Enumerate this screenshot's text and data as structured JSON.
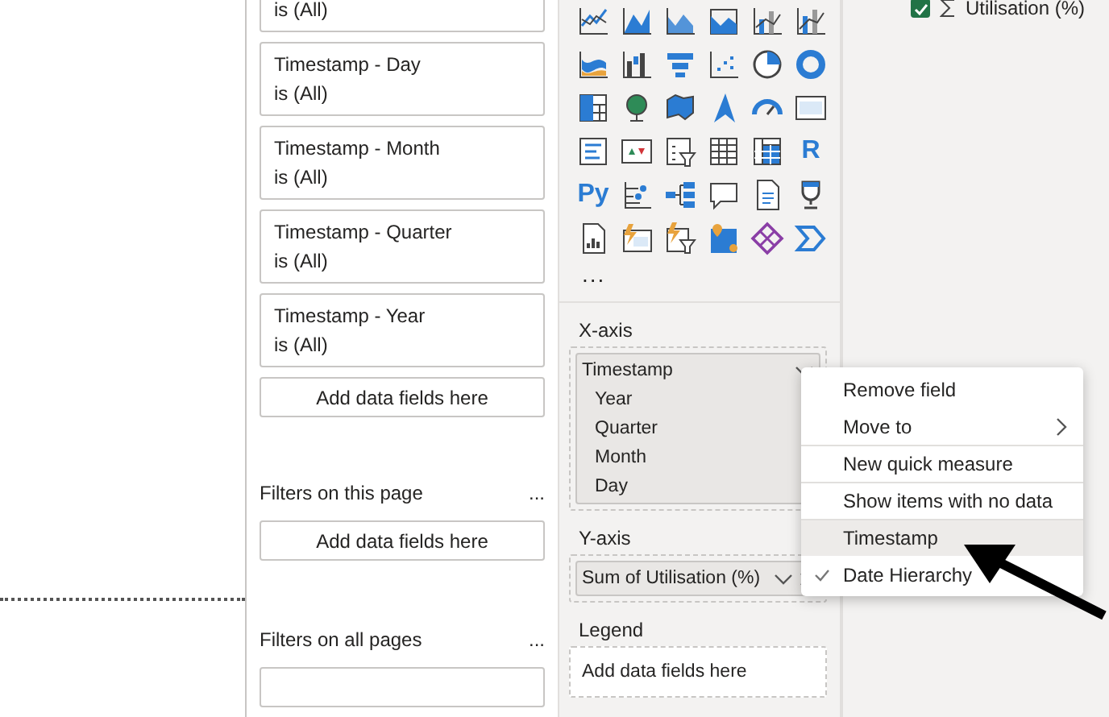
{
  "filters_pane": {
    "visual_filters": [
      {
        "condition": "is (All)"
      },
      {
        "title": "Timestamp - Day",
        "condition": "is (All)"
      },
      {
        "title": "Timestamp - Month",
        "condition": "is (All)"
      },
      {
        "title": "Timestamp - Quarter",
        "condition": "is (All)"
      },
      {
        "title": "Timestamp - Year",
        "condition": "is (All)"
      }
    ],
    "visual_drop_zone": "Add data fields here",
    "page_filters": {
      "title": "Filters on this page",
      "more": "...",
      "drop_zone": "Add data fields here"
    },
    "all_pages_filters": {
      "title": "Filters on all pages",
      "more": "..."
    }
  },
  "visualizations": {
    "glyph_tiles": [
      "R",
      "Py"
    ],
    "more": "...",
    "wells": [
      {
        "label": "X-axis",
        "field": {
          "name": "Timestamp",
          "removable": false,
          "children": [
            "Year",
            "Quarter",
            "Month",
            "Day"
          ]
        }
      },
      {
        "label": "Y-axis",
        "field": {
          "name": "Sum of Utilisation (%)",
          "removable": true
        }
      },
      {
        "label": "Legend",
        "placeholder": "Add data fields here"
      }
    ]
  },
  "context_menu": {
    "items": [
      {
        "label": "Remove field",
        "kind": "item",
        "separator_before": false,
        "selected": false,
        "checked": false
      },
      {
        "label": "Move to",
        "kind": "submenu",
        "separator_before": false,
        "selected": false,
        "checked": false
      },
      {
        "label": "New quick measure",
        "kind": "item",
        "separator_before": true,
        "selected": false,
        "checked": false
      },
      {
        "label": "Show items with no data",
        "kind": "item",
        "separator_before": true,
        "selected": false,
        "checked": false
      },
      {
        "label": "Timestamp",
        "kind": "item",
        "separator_before": true,
        "selected": true,
        "checked": false
      },
      {
        "label": "Date Hierarchy",
        "kind": "item",
        "separator_before": false,
        "selected": false,
        "checked": true
      }
    ]
  },
  "fields_pane": {
    "items": [
      {
        "label": "Utilisation (%)",
        "checked": true
      }
    ]
  }
}
